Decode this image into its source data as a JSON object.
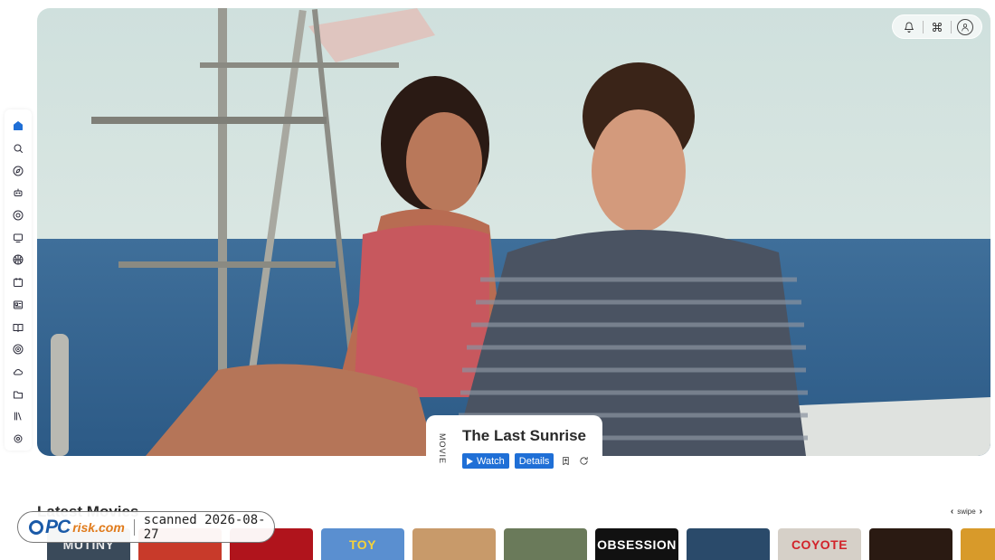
{
  "sidebar": {
    "items": [
      {
        "icon": "home-icon",
        "active": true
      },
      {
        "icon": "search-icon"
      },
      {
        "icon": "compass-icon"
      },
      {
        "icon": "robot-icon"
      },
      {
        "icon": "aperture-icon"
      },
      {
        "icon": "monitor-icon"
      },
      {
        "icon": "basketball-icon"
      },
      {
        "icon": "calendar-icon"
      },
      {
        "icon": "news-icon"
      },
      {
        "icon": "book-icon"
      },
      {
        "icon": "target-icon"
      },
      {
        "icon": "cloud-icon"
      },
      {
        "icon": "folder-icon"
      },
      {
        "icon": "library-icon"
      },
      {
        "icon": "settings-icon"
      }
    ]
  },
  "header": {
    "icons": [
      "bell-icon",
      "command-icon",
      "user-icon"
    ]
  },
  "feature": {
    "type": "MOVIE",
    "title": "The Last Sunrise",
    "watch_label": "Watch",
    "details_label": "Details"
  },
  "latest": {
    "title": "Latest Movies",
    "swipe_label": "swipe",
    "posters": [
      {
        "title": "MUTINY",
        "bg": "#3a4a5a",
        "color": "#e8e8e8"
      },
      {
        "title": "",
        "bg": "#c83a2a",
        "color": "#fff"
      },
      {
        "title": "",
        "bg": "#b0141c",
        "color": "#fff"
      },
      {
        "title": "TOY",
        "bg": "#5a8fd0",
        "color": "#f5d23a"
      },
      {
        "title": "",
        "bg": "#c89a6a",
        "color": "#fff"
      },
      {
        "title": "",
        "bg": "#6a7a5a",
        "color": "#fff"
      },
      {
        "title": "OBSESSION",
        "bg": "#111111",
        "color": "#ffffff"
      },
      {
        "title": "",
        "bg": "#2a4a6a",
        "color": "#fff"
      },
      {
        "title": "COYOTE",
        "bg": "#d6d0c8",
        "color": "#d2232a"
      },
      {
        "title": "",
        "bg": "#2a1a12",
        "color": "#fff"
      },
      {
        "title": "",
        "bg": "#d89a2a",
        "color": "#fff"
      }
    ]
  },
  "watermark": {
    "logo_pc": "PC",
    "logo_risk": "risk.com",
    "text": "scanned 2026-08-27"
  }
}
